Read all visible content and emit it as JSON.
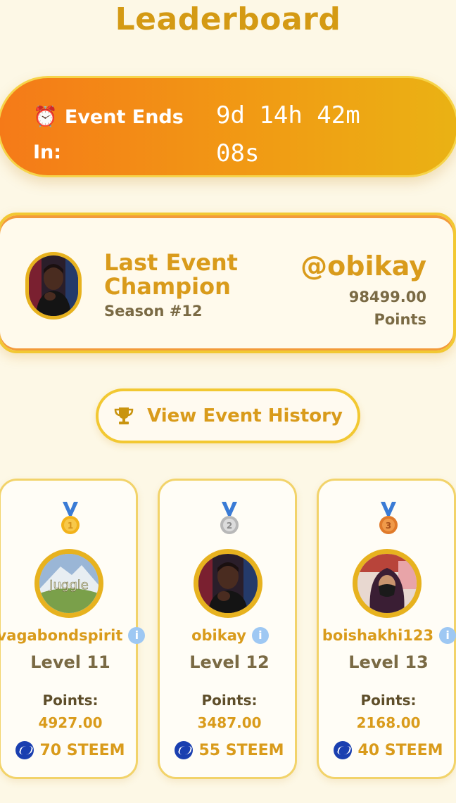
{
  "header": {
    "title": "Leaderboard"
  },
  "timer": {
    "label": "Event Ends In:",
    "icon": "alarm-clock-icon",
    "line1": "9d 14h 42m",
    "line2": "08s"
  },
  "champion": {
    "title": "Last Event Champion",
    "season": "Season #12",
    "username": "@obikay",
    "points": "98499.00",
    "points_label": "Points"
  },
  "history_button": {
    "label": "View Event History",
    "icon": "trophy-icon"
  },
  "podium": [
    {
      "rank": 1,
      "medal": "gold-medal-icon",
      "name": "vagabondspirit",
      "level": "Level 11",
      "points_label": "Points:",
      "points": "4927.00",
      "reward": "70 STEEM"
    },
    {
      "rank": 2,
      "medal": "silver-medal-icon",
      "name": "obikay",
      "level": "Level 12",
      "points_label": "Points:",
      "points": "3487.00",
      "reward": "55 STEEM"
    },
    {
      "rank": 3,
      "medal": "bronze-medal-icon",
      "name": "boishakhi123",
      "level": "Level 13",
      "points_label": "Points:",
      "points": "2168.00",
      "reward": "40 STEEM"
    }
  ],
  "colors": {
    "accent": "#d99b1b",
    "background": "#fdf8e6",
    "timer_start": "#f57a18",
    "timer_end": "#eab214",
    "steem_blue": "#1a3fb0"
  }
}
